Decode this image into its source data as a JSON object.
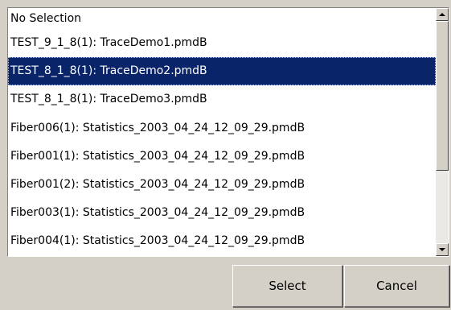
{
  "list": {
    "items": [
      {
        "label": "No Selection",
        "selected": false
      },
      {
        "label": "TEST_9_1_8(1): TraceDemo1.pmdB",
        "selected": false
      },
      {
        "label": "TEST_8_1_8(1): TraceDemo2.pmdB",
        "selected": true
      },
      {
        "label": "TEST_8_1_8(1): TraceDemo3.pmdB",
        "selected": false
      },
      {
        "label": "Fiber006(1): Statistics_2003_04_24_12_09_29.pmdB",
        "selected": false
      },
      {
        "label": "Fiber001(1): Statistics_2003_04_24_12_09_29.pmdB",
        "selected": false
      },
      {
        "label": "Fiber001(2): Statistics_2003_04_24_12_09_29.pmdB",
        "selected": false
      },
      {
        "label": "Fiber003(1): Statistics_2003_04_24_12_09_29.pmdB",
        "selected": false
      },
      {
        "label": "Fiber004(1): Statistics_2003_04_24_12_09_29.pmdB",
        "selected": false
      }
    ]
  },
  "buttons": {
    "select_label": "Select",
    "cancel_label": "Cancel"
  },
  "colors": {
    "selection_background": "#0a246a",
    "selection_text": "#ffffff",
    "dialog_background": "#d4d0c8"
  },
  "icons": {
    "scroll_up": "arrow-up-icon",
    "scroll_down": "arrow-down-icon"
  }
}
